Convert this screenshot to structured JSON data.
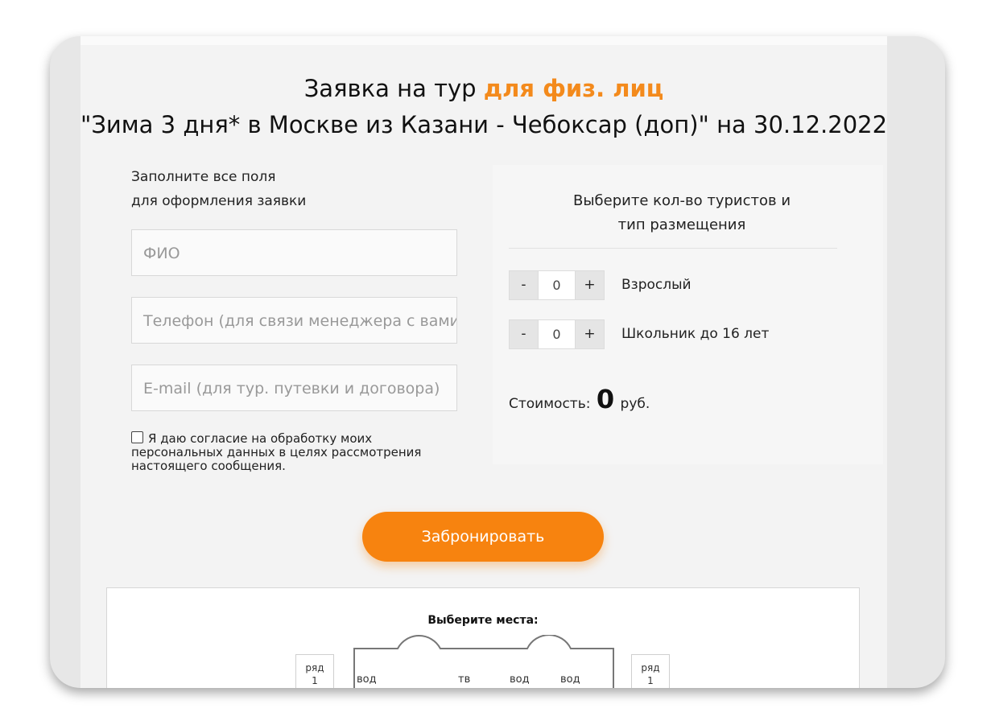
{
  "title": {
    "line1_prefix": "Заявка на тур",
    "line1_accent": "для физ. лиц",
    "line2": "\"Зима 3 дня* в Москве из Казани - Чебоксар (доп)\" на 30.12.2022"
  },
  "form": {
    "hint_line1": "Заполните все поля",
    "hint_line2": "для оформления заявки",
    "name_placeholder": "ФИО",
    "phone_placeholder": "Телефон (для связи менеджера с вами)",
    "email_placeholder": "E-mail (для тур. путевки и договора)",
    "consent_text": "Я даю согласие на обработку моих персональных данных в целях рассмотрения настоящего сообщения."
  },
  "tourists": {
    "title_line1": "Выберите кол-во туристов и",
    "title_line2": "тип размещения",
    "rows": [
      {
        "minus": "-",
        "value": "0",
        "plus": "+",
        "label": "Взрослый"
      },
      {
        "minus": "-",
        "value": "0",
        "plus": "+",
        "label": "Школьник до 16 лет"
      }
    ],
    "cost_label": "Стоимость:",
    "cost_value": "0",
    "cost_currency": "руб."
  },
  "book_button": "Забронировать",
  "seats": {
    "title": "Выберите места:",
    "row_word": "ряд",
    "row_number": "1",
    "bus_labels": [
      "вод",
      "тв",
      "вод",
      "вод"
    ]
  },
  "colors": {
    "accent": "#f38a1c",
    "button": "#f7830f"
  }
}
